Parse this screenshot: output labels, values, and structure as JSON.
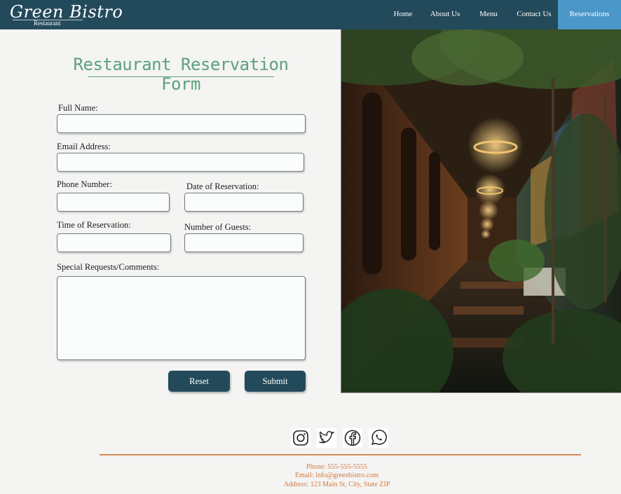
{
  "brand": {
    "name": "Green Bistro",
    "tagline": "Restaurant"
  },
  "nav": {
    "items": [
      {
        "label": "Home"
      },
      {
        "label": "About Us"
      },
      {
        "label": "Menu"
      },
      {
        "label": "Contact Us"
      },
      {
        "label": "Reservations",
        "active": true
      }
    ]
  },
  "form": {
    "title": "Restaurant Reservation Form",
    "full_name_label": "Full Name:",
    "email_label": "Email Address:",
    "phone_label": "Phone Number:",
    "date_label": "Date of Reservation:",
    "time_label": "Time of Reservation:",
    "guests_label": "Number of Guests:",
    "comments_label": "Special Requests/Comments:",
    "reset_label": "Reset",
    "submit_label": "Submit"
  },
  "footer": {
    "social": [
      "instagram-icon",
      "twitter-icon",
      "facebook-icon",
      "whatsapp-icon"
    ],
    "phone": "Phone: 555-555-5555",
    "email": "Email: info@greenbistro.com",
    "address": "Address: 123 Main St, City, State ZIP"
  },
  "colors": {
    "nav_bg": "#234a5b",
    "nav_active": "#4b97c9",
    "title": "#5ca07c",
    "button": "#234a5b",
    "footer_text": "#d2793f",
    "footer_rule": "#d48a55"
  }
}
